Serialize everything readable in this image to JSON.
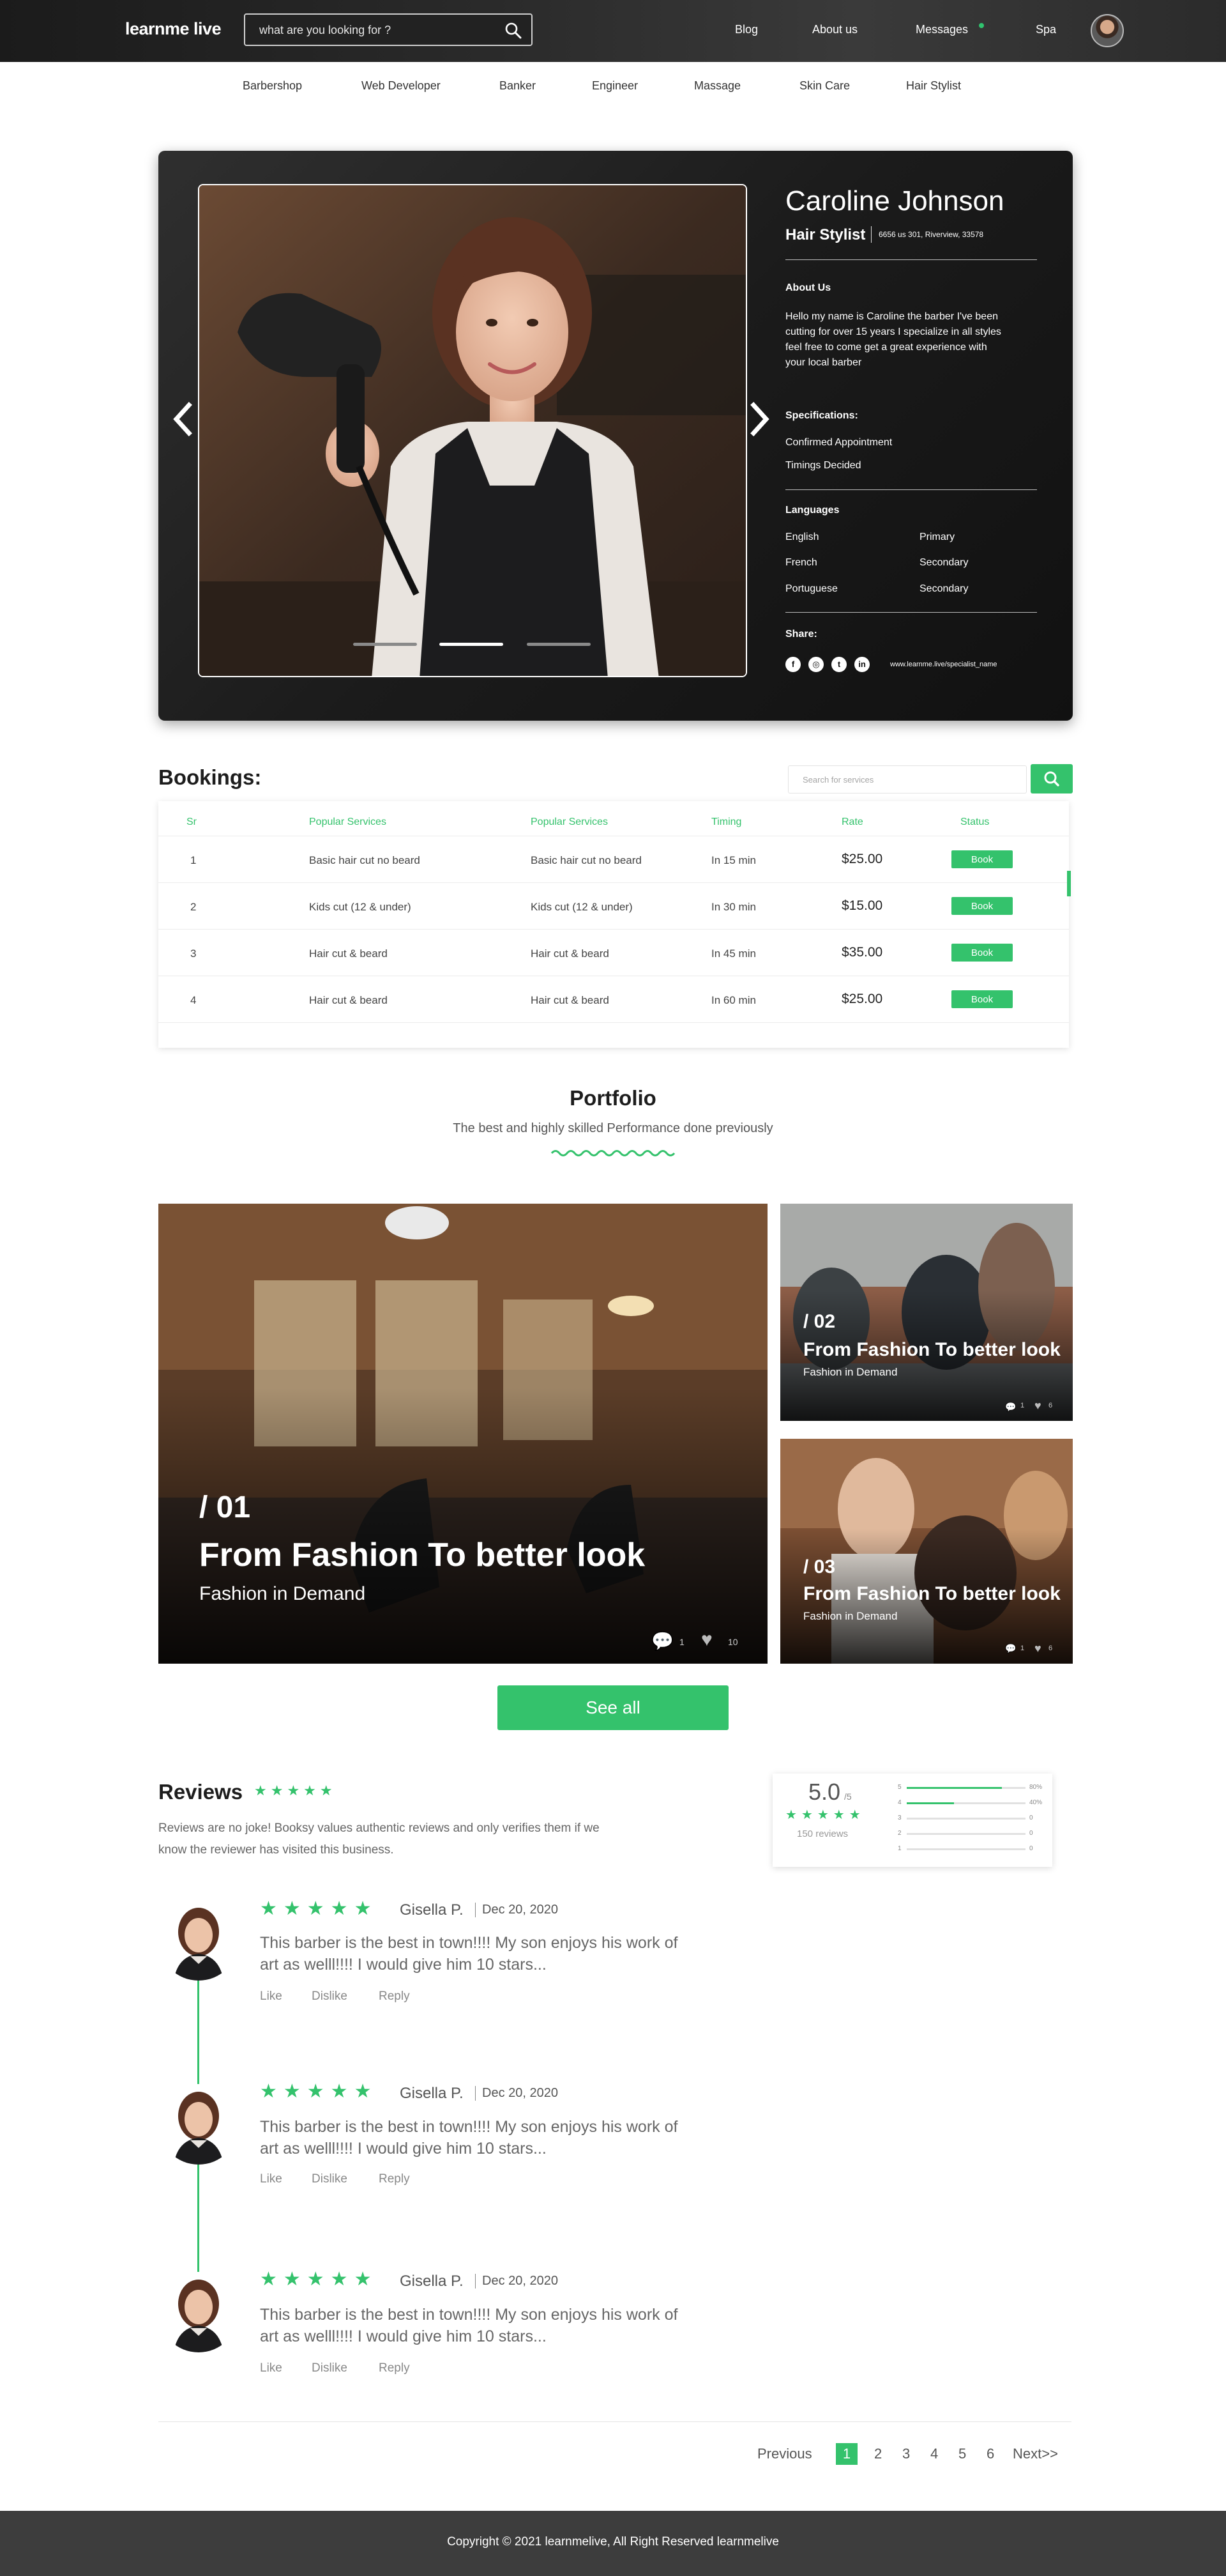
{
  "header": {
    "logo": "learnme live",
    "search_placeholder": "what are you looking for ?",
    "nav": [
      "Blog",
      "About us",
      "Messages",
      "Spa"
    ]
  },
  "categories": [
    "Barbershop",
    "Web Developer",
    "Banker",
    "Engineer",
    "Massage",
    "Skin Care",
    "Hair Stylist"
  ],
  "profile": {
    "name": "Caroline Johnson",
    "role": "Hair Stylist",
    "address": "6656 us 301, Riverview, 33578",
    "about_heading": "About Us",
    "about_text": "Hello my name is Caroline  the barber I've been cutting for over 15 years I specialize in all styles feel free to come get a great experience with your local barber",
    "spec_heading": "Specifications:",
    "specs": [
      "Confirmed Appointment",
      "Timings Decided"
    ],
    "lang_heading": "Languages",
    "languages": [
      {
        "name": "English",
        "level": "Primary"
      },
      {
        "name": "French",
        "level": "Secondary"
      },
      {
        "name": "Portuguese",
        "level": "Secondary"
      }
    ],
    "share_heading": "Share:",
    "share_url": "www.learnme.live/specialist_name",
    "social_icons": [
      "facebook-icon",
      "instagram-icon",
      "twitter-icon",
      "linkedin-icon"
    ]
  },
  "bookings": {
    "title": "Bookings:",
    "search_placeholder": "Search for services",
    "headers": [
      "Sr",
      "Popular Services",
      "Popular Services",
      "Timing",
      "Rate",
      "Status"
    ],
    "rows": [
      {
        "sr": "1",
        "svc1": "Basic hair cut no beard",
        "svc2": "Basic hair cut no beard",
        "timing": "In 15 min",
        "rate": "$25.00",
        "status": "Book"
      },
      {
        "sr": "2",
        "svc1": "Kids cut (12 & under)",
        "svc2": "Kids cut (12 & under)",
        "timing": "In 30 min",
        "rate": "$15.00",
        "status": "Book"
      },
      {
        "sr": "3",
        "svc1": "Hair cut & beard",
        "svc2": "Hair cut & beard",
        "timing": "In 45 min",
        "rate": "$35.00",
        "status": "Book"
      },
      {
        "sr": "4",
        "svc1": "Hair cut & beard",
        "svc2": "Hair cut & beard",
        "timing": "In 60 min",
        "rate": "$25.00",
        "status": "Book"
      }
    ]
  },
  "portfolio": {
    "title": "Portfolio",
    "subtitle": "The best and highly skilled Performance done previously",
    "items": [
      {
        "num": "/ 01",
        "title": "From Fashion To better look",
        "sub": "Fashion in Demand",
        "comments": "1",
        "likes": "10"
      },
      {
        "num": "/ 02",
        "title": "From Fashion To better look",
        "sub": "Fashion in Demand",
        "comments": "1",
        "likes": "6"
      },
      {
        "num": "/ 03",
        "title": "From Fashion To better look",
        "sub": "Fashion in Demand",
        "comments": "1",
        "likes": "6"
      }
    ],
    "see_all": "See all"
  },
  "reviews": {
    "title": "Reviews",
    "title_stars": "★★★★★",
    "description": "Reviews are no joke! Booksy values authentic reviews and only verifies them if we know the reviewer has visited this business.",
    "summary": {
      "score": "5.0",
      "out_of": "/5",
      "stars": "★★★★★",
      "count": "150 reviews",
      "bars": [
        {
          "label": "5",
          "pct": "80%",
          "value": 80
        },
        {
          "label": "4",
          "pct": "40%",
          "value": 40
        },
        {
          "label": "3",
          "pct": "0",
          "value": 0
        },
        {
          "label": "2",
          "pct": "0",
          "value": 0
        },
        {
          "label": "1",
          "pct": "0",
          "value": 0
        }
      ]
    },
    "items": [
      {
        "stars": "★★★★★",
        "name": "Gisella P.",
        "date": "Dec 20, 2020",
        "text": "This barber is the best in town!!!! My son enjoys his work of art as welll!!!! I would give him 10 stars...",
        "like": "Like",
        "dislike": "Dislike",
        "reply": "Reply"
      },
      {
        "stars": "★★★★★",
        "name": "Gisella P.",
        "date": "Dec 20, 2020",
        "text": "This barber is the best in town!!!! My son enjoys his work of art as welll!!!! I would give him 10 stars...",
        "like": "Like",
        "dislike": "Dislike",
        "reply": "Reply"
      },
      {
        "stars": "★★★★★",
        "name": "Gisella P.",
        "date": "Dec 20, 2020",
        "text": "This barber is the best in town!!!! My son enjoys his work of art as welll!!!! I would give him 10 stars...",
        "like": "Like",
        "dislike": "Dislike",
        "reply": "Reply"
      }
    ]
  },
  "pagination": {
    "previous": "Previous",
    "pages": [
      "1",
      "2",
      "3",
      "4",
      "5",
      "6"
    ],
    "next": "Next>>"
  },
  "footer": {
    "copyright": "Copyright © 2021 learnmelive, All Right Reserved learnmelive"
  },
  "colors": {
    "accent": "#34c26c",
    "header": "#2a2a2a",
    "footer": "#3d3d3d"
  }
}
